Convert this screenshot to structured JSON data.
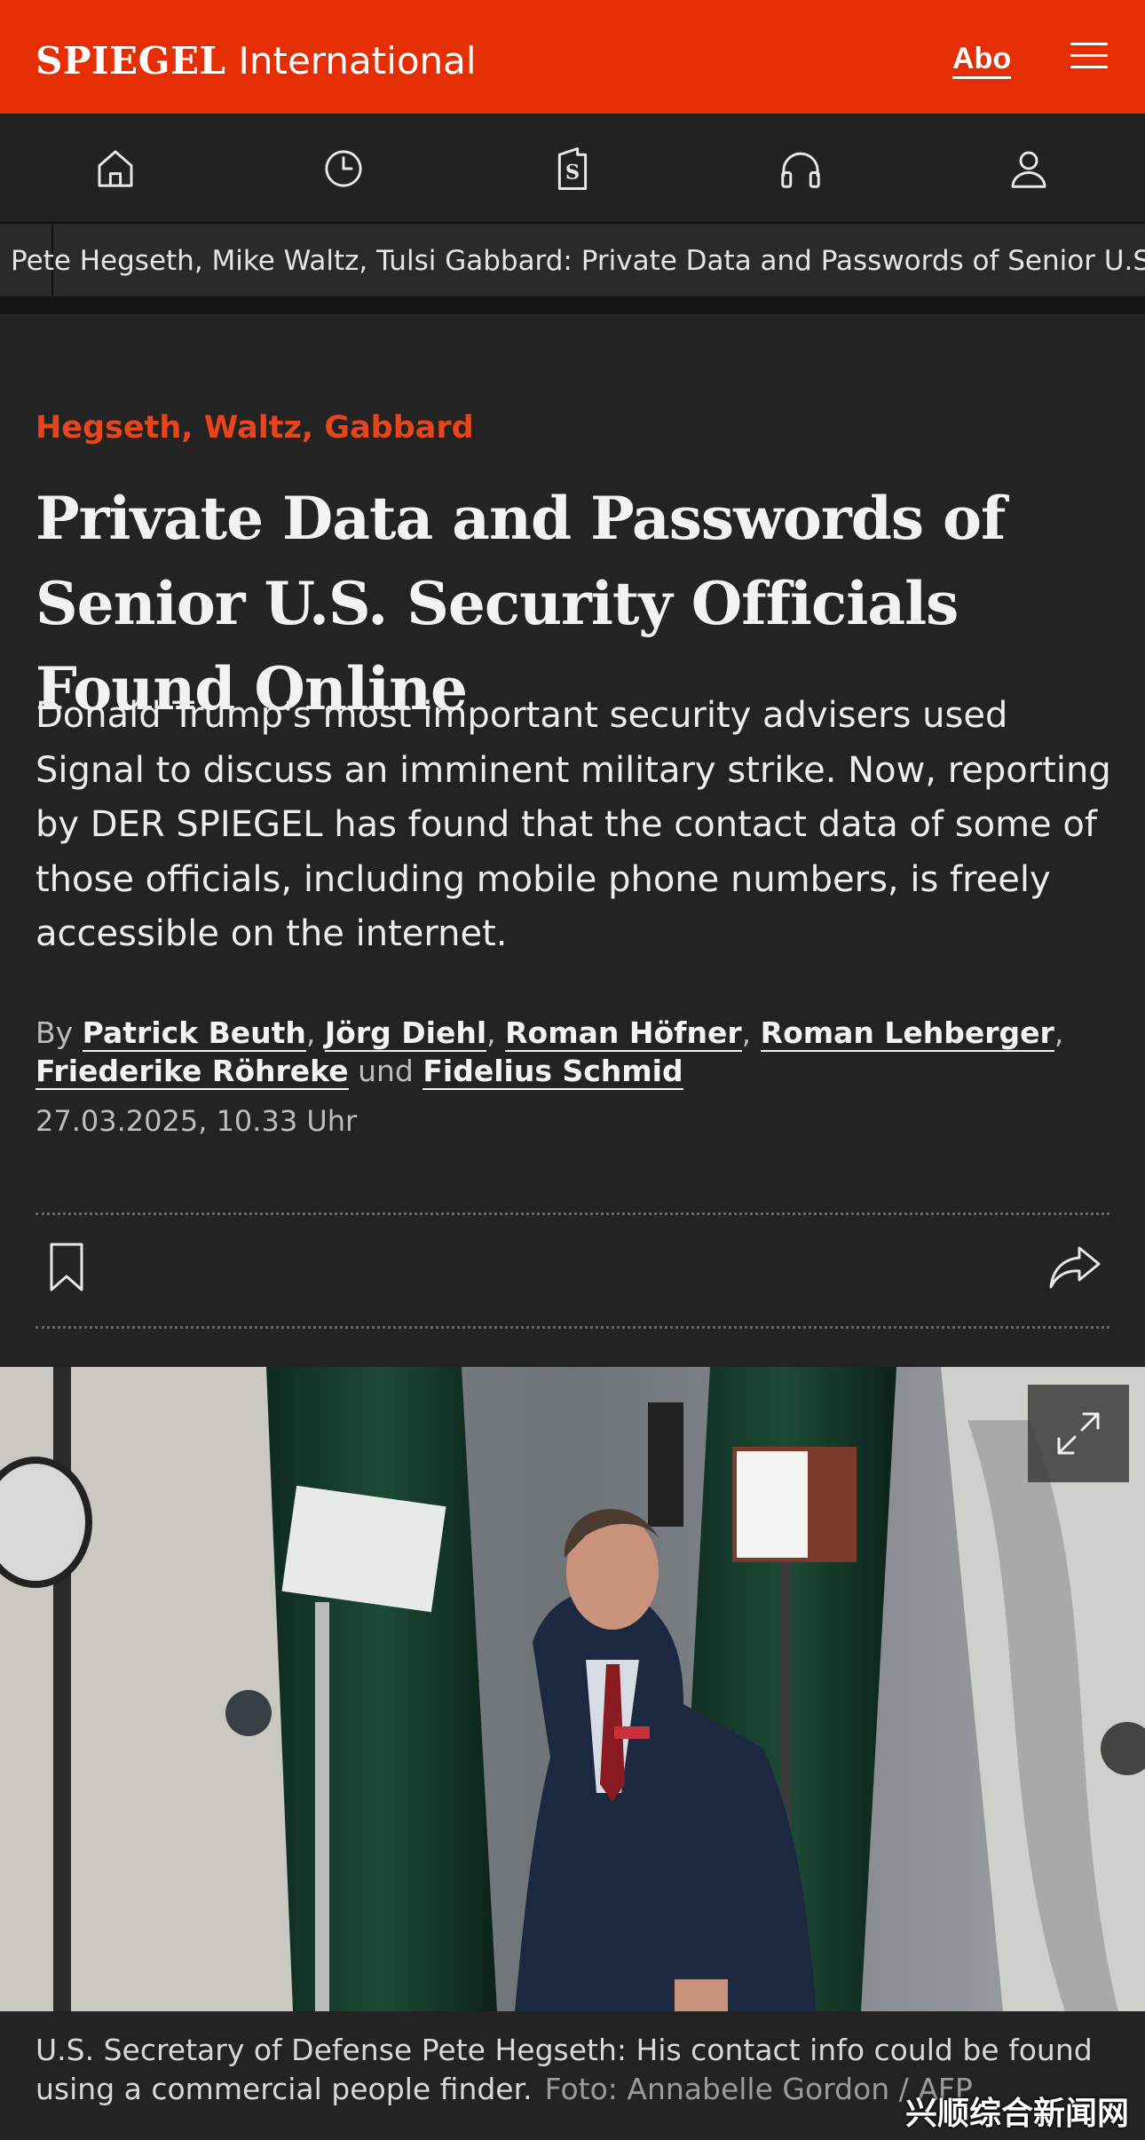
{
  "header": {
    "brand": "SPIEGEL",
    "section": "International",
    "abo_label": "Abo"
  },
  "nav": {
    "icons": [
      "home-icon",
      "clock-icon",
      "spiegel-plus-icon",
      "headphones-icon",
      "profile-icon"
    ]
  },
  "ticker": {
    "text": "Pete Hegseth, Mike Waltz, Tulsi Gabbard: Private Data and Passwords of Senior U.S. Security Officials Found Online"
  },
  "article": {
    "kicker": "Hegseth, Waltz, Gabbard",
    "headline": "Private Data and Passwords of Senior U.S. Security Officials Found Online",
    "lead": "Donald Trump's most important security advisers used Signal to discuss an imminent military strike. Now, reporting by DER SPIEGEL has found that the contact data of some of those officials, including mobile phone numbers, is freely accessible on the internet.",
    "byline_prefix": "By",
    "authors": [
      "Patrick Beuth",
      "Jörg Diehl",
      "Roman Höfner",
      "Roman Lehberger",
      "Friederike Röhreke",
      "Fidelius Schmid"
    ],
    "separator": ",",
    "conjunction": "und",
    "date": "27.03.2025, 10.33 Uhr"
  },
  "photo": {
    "caption": "U.S. Secretary of Defense Pete Hegseth: His contact info could be found using a commercial people finder.",
    "credit": "Foto: Annabelle Gordon / AFP"
  },
  "watermark": "兴顺综合新闻网",
  "colors": {
    "brand_red": "#e62e04",
    "kicker": "#e8451a",
    "background": "#232323"
  }
}
